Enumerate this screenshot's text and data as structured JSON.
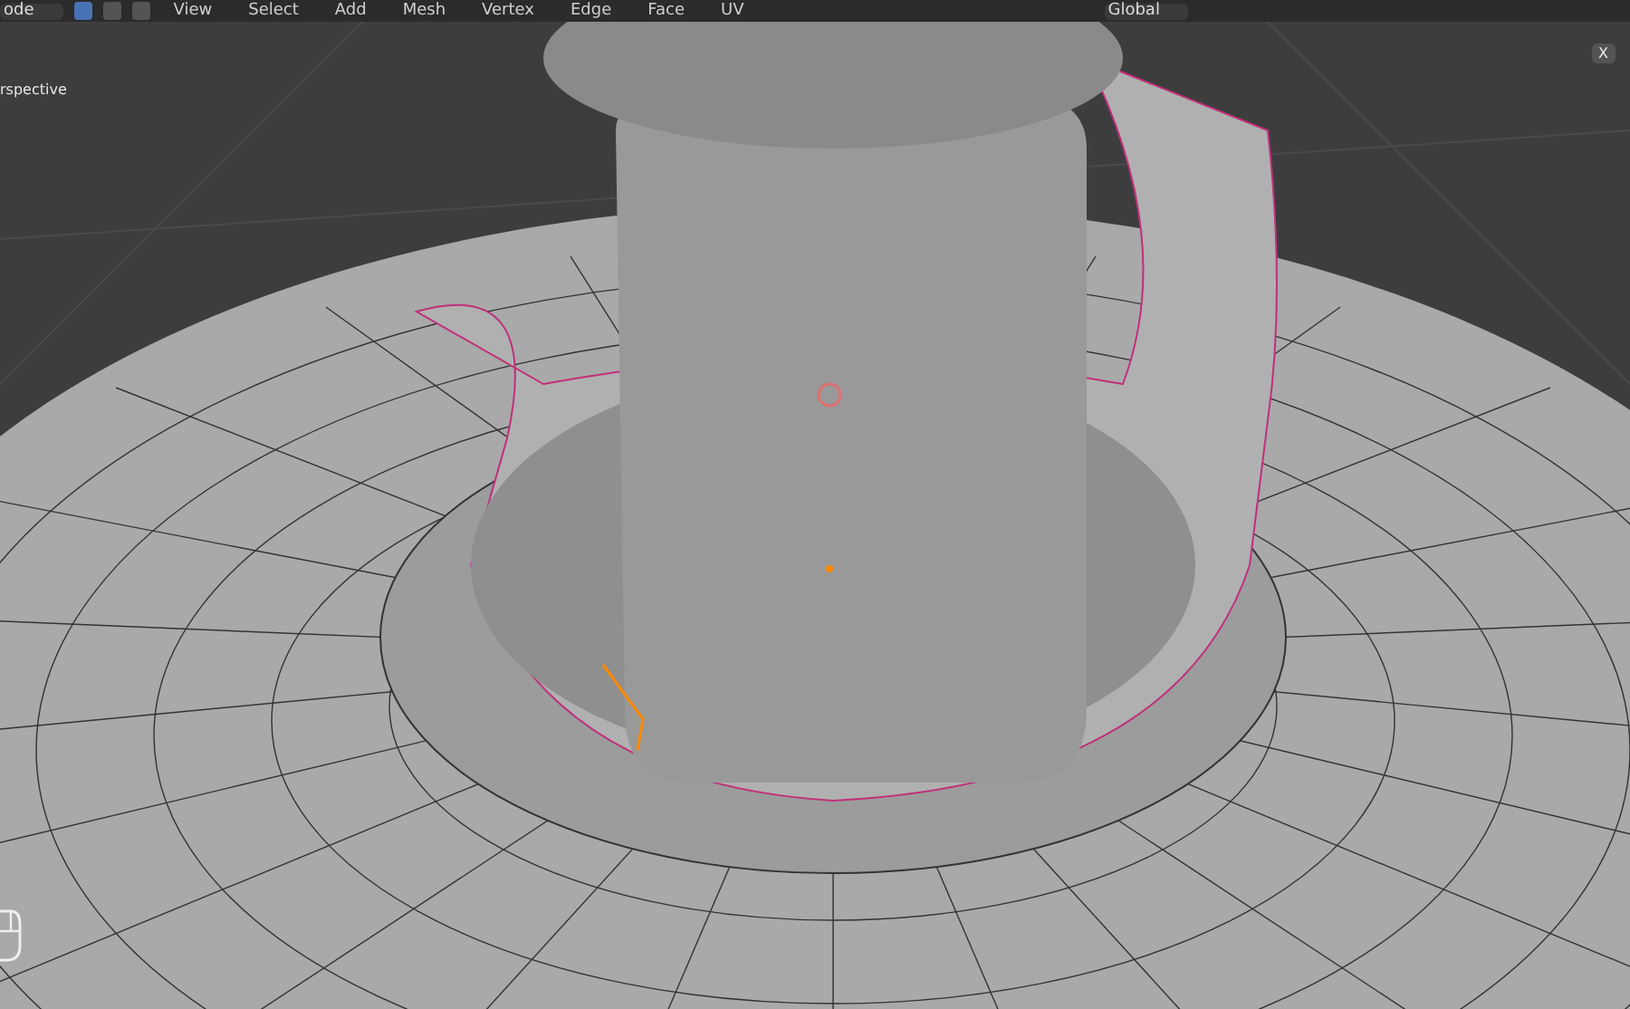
{
  "header": {
    "mode": "ode",
    "select_modes": [
      {
        "selected": true
      },
      {
        "selected": false
      },
      {
        "selected": false
      }
    ],
    "menus": [
      "View",
      "Select",
      "Add",
      "Mesh",
      "Vertex",
      "Edge",
      "Face",
      "UV"
    ],
    "orientation": "Global"
  },
  "viewport": {
    "view_label": "rspective",
    "axis_button": "X"
  }
}
